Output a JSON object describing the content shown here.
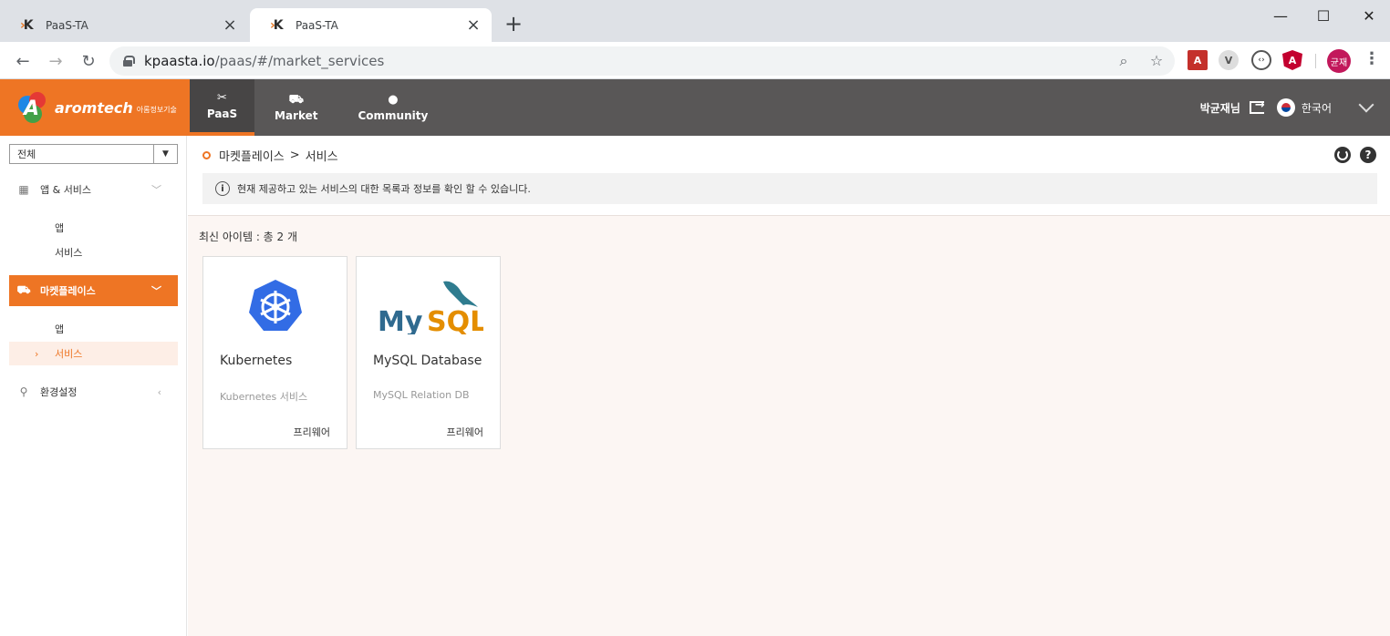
{
  "browser": {
    "tabs": [
      {
        "title": "PaaS-TA"
      },
      {
        "title": "PaaS-TA"
      }
    ],
    "url_host": "kpaasta.io",
    "url_path": "/paas/#/market_services",
    "profile_initials": "균재"
  },
  "header": {
    "logo_text": "aromtech",
    "logo_sub": "아롬정보기술",
    "nav": [
      {
        "label": "PaaS",
        "icon": "tools-icon"
      },
      {
        "label": "Market",
        "icon": "cart-icon"
      },
      {
        "label": "Community",
        "icon": "chat-icon"
      }
    ],
    "user_name": "박균재님",
    "language": "한국어"
  },
  "sidebar": {
    "filter_value": "전체",
    "groups": [
      {
        "label": "앱 & 서비스",
        "items": [
          "앱",
          "서비스"
        ]
      },
      {
        "label": "마켓플레이스",
        "items": [
          "앱",
          "서비스"
        ]
      },
      {
        "label": "환경설정",
        "items": []
      }
    ]
  },
  "main": {
    "breadcrumb": [
      "마켓플레이스",
      "서비스"
    ],
    "breadcrumb_sep": ">",
    "info_text": "현재 제공하고 있는 서비스의 대한 목록과 정보를 확인 할 수 있습니다.",
    "count_label": "최신 아이템 : 총 2 개",
    "cards": [
      {
        "title": "Kubernetes",
        "desc": "Kubernetes 서비스",
        "price": "프리웨어",
        "logo": "kubernetes-logo"
      },
      {
        "title": "MySQL Database",
        "desc": "MySQL Relation DB",
        "price": "프리웨어",
        "logo": "mysql-logo"
      }
    ]
  },
  "colors": {
    "accent": "#ee7524",
    "header_bg": "#595757",
    "main_bg": "#fcf6f3"
  }
}
